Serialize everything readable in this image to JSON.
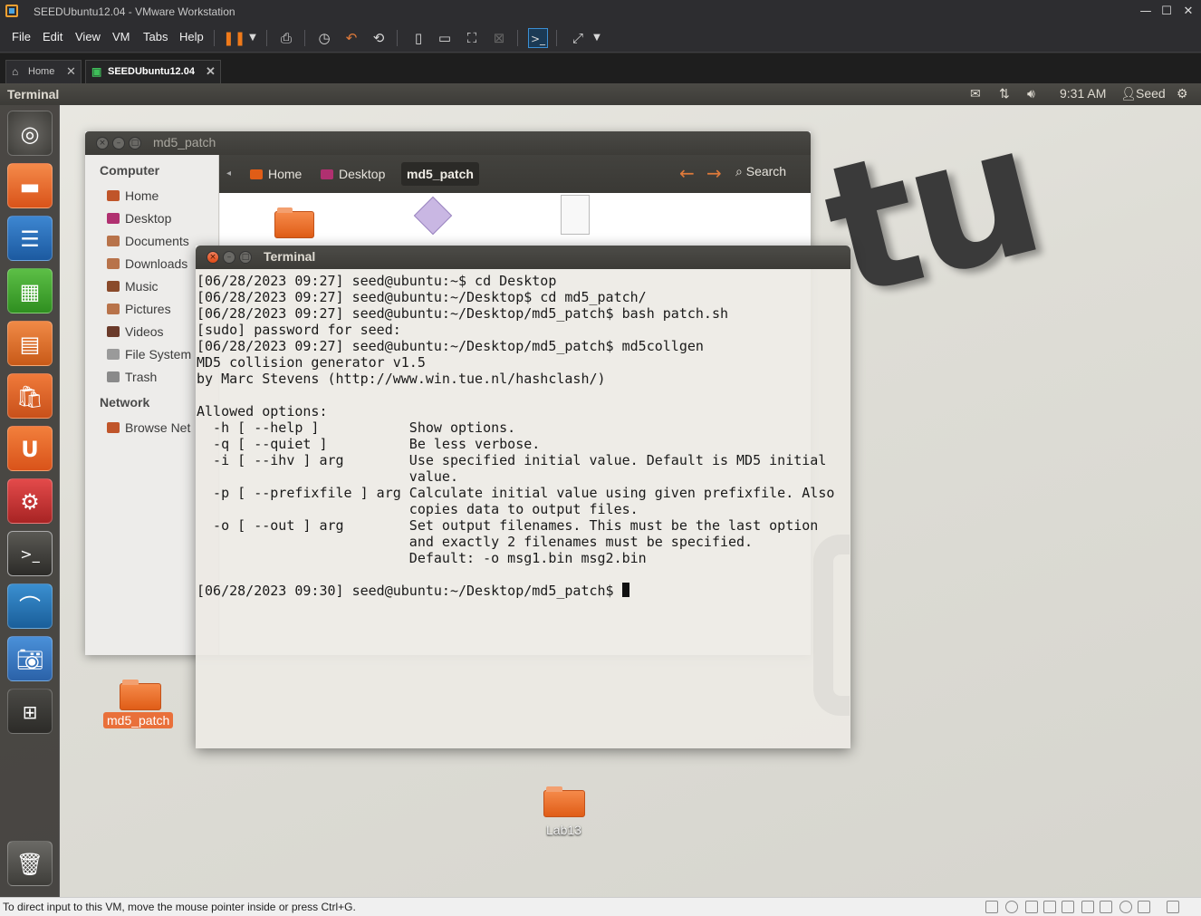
{
  "vm_window": {
    "title": "SEEDUbuntu12.04 - VMware Workstation",
    "minimize": "—",
    "maximize": "☐",
    "close": "✕"
  },
  "menubar": {
    "items": [
      "File",
      "Edit",
      "View",
      "VM",
      "Tabs",
      "Help"
    ]
  },
  "tabs": [
    {
      "label": "Home",
      "icon": "home-icon",
      "close": "✕"
    },
    {
      "label": "SEEDUbuntu12.04",
      "icon": "vm-icon",
      "close": "✕",
      "active": true
    }
  ],
  "ubuntu_panel": {
    "active_app": "Terminal",
    "clock": "9:31 AM",
    "user": "Seed",
    "indicators": [
      "mail-icon",
      "network-icon",
      "volume-icon",
      "gear-icon"
    ]
  },
  "launcher": {
    "items": [
      "ubuntu-dash-icon",
      "files-icon",
      "writer-icon",
      "calc-icon",
      "impress-icon",
      "software-center-icon",
      "ubuntu-one-icon",
      "system-settings-icon",
      "terminal-icon",
      "wireshark-icon",
      "screenshot-icon",
      "workspace-switcher-icon",
      "trash-icon"
    ]
  },
  "file_manager": {
    "title": "md5_patch",
    "breadcrumbs": [
      "Home",
      "Desktop",
      "md5_patch"
    ],
    "search_label": "Search",
    "sidebar": {
      "computer_header": "Computer",
      "items": [
        "Home",
        "Desktop",
        "Documents",
        "Downloads",
        "Music",
        "Pictures",
        "Videos",
        "File System",
        "Trash"
      ],
      "network_header": "Network",
      "network_items": [
        "Browse Net"
      ]
    }
  },
  "terminal": {
    "title": "Terminal",
    "lines": [
      "[06/28/2023 09:27] seed@ubuntu:~$ cd Desktop",
      "[06/28/2023 09:27] seed@ubuntu:~/Desktop$ cd md5_patch/",
      "[06/28/2023 09:27] seed@ubuntu:~/Desktop/md5_patch$ bash patch.sh",
      "[sudo] password for seed:",
      "[06/28/2023 09:27] seed@ubuntu:~/Desktop/md5_patch$ md5collgen",
      "MD5 collision generator v1.5",
      "by Marc Stevens (http://www.win.tue.nl/hashclash/)",
      "",
      "Allowed options:",
      "  -h [ --help ]           Show options.",
      "  -q [ --quiet ]          Be less verbose.",
      "  -i [ --ihv ] arg        Use specified initial value. Default is MD5 initial",
      "                          value.",
      "  -p [ --prefixfile ] arg Calculate initial value using given prefixfile. Also",
      "                          copies data to output files.",
      "  -o [ --out ] arg        Set output filenames. This must be the last option",
      "                          and exactly 2 filenames must be specified.",
      "                          Default: -o msg1.bin msg2.bin",
      "",
      "[06/28/2023 09:30] seed@ubuntu:~/Desktop/md5_patch$ "
    ]
  },
  "desktop": {
    "icons": [
      {
        "label": "md5_patch",
        "selected": true
      },
      {
        "label": "Lab13",
        "selected": false
      }
    ],
    "wallpaper_text": "tu"
  },
  "statusbar": {
    "hint": "To direct input to this VM, move the mouse pointer inside or press Ctrl+G."
  },
  "colors": {
    "ubuntu_orange": "#e05d17",
    "panel_dark": "#3c3b37",
    "vmware_chrome": "#2d2d30"
  }
}
